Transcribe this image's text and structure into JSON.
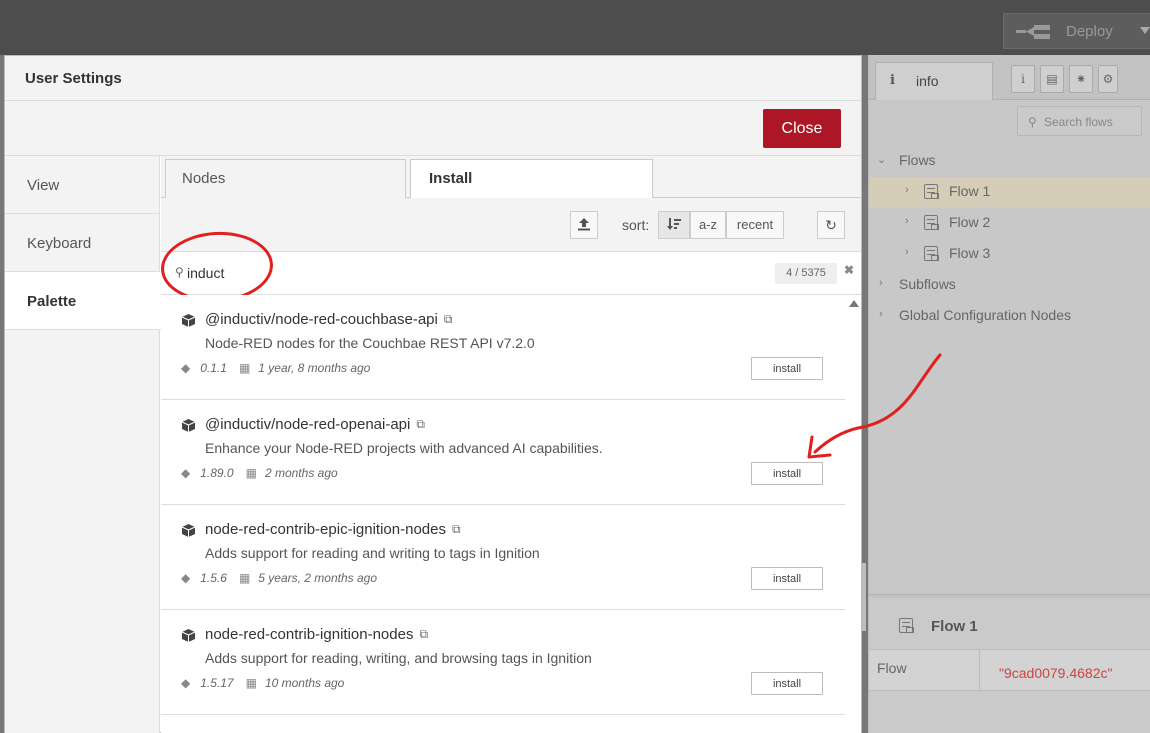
{
  "header": {
    "deploy_label": "Deploy"
  },
  "sidebar": {
    "tab_info_label": "info",
    "tab_info_glyph": "i",
    "search_placeholder": "Search flows",
    "tree": {
      "flows_label": "Flows",
      "flows": [
        "Flow 1",
        "Flow 2",
        "Flow 3"
      ],
      "subflows_label": "Subflows",
      "global_config_label": "Global Configuration Nodes"
    },
    "bottom": {
      "title": "Flow 1",
      "prop_key": "Flow",
      "prop_value": "\"9cad0079.4682c\""
    }
  },
  "dialog": {
    "title": "User Settings",
    "close_label": "Close",
    "left_tabs": [
      "View",
      "Keyboard",
      "Palette"
    ],
    "tabs": {
      "nodes": "Nodes",
      "install": "Install"
    },
    "toolbar": {
      "sort_label": "sort:",
      "az_label": "a-z",
      "recent_label": "recent"
    },
    "search": {
      "value": "induct",
      "count": "4 / 5375"
    },
    "results": [
      {
        "name": "@inductiv/node-red-couchbase-api",
        "description": "Node-RED nodes for the Couchbae REST API v7.2.0",
        "version": "0.1.1",
        "updated": "1 year, 8 months ago",
        "install_label": "install"
      },
      {
        "name": "@inductiv/node-red-openai-api",
        "description": "Enhance your Node-RED projects with advanced AI capabilities.",
        "version": "1.89.0",
        "updated": "2 months ago",
        "install_label": "install"
      },
      {
        "name": "node-red-contrib-epic-ignition-nodes",
        "description": "Adds support for reading and writing to tags in Ignition",
        "version": "1.5.6",
        "updated": "5 years, 2 months ago",
        "install_label": "install"
      },
      {
        "name": "node-red-contrib-ignition-nodes",
        "description": "Adds support for reading, writing, and browsing tags in Ignition",
        "version": "1.5.17",
        "updated": "10 months ago",
        "install_label": "install"
      }
    ]
  },
  "colors": {
    "accent_red": "#ad1625",
    "annotation_red": "#e02020",
    "selected_flow_bg": "#d6cdb8"
  }
}
